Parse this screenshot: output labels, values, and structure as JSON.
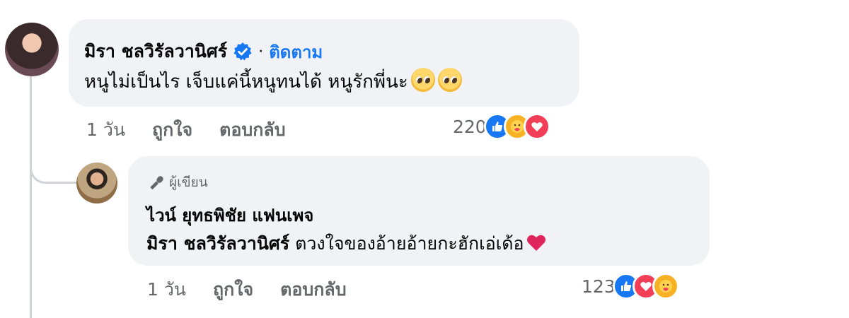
{
  "main_comment": {
    "author": "มิรา ชลวิรัลวานิศร์",
    "separator": "·",
    "follow_label": "ติดตาม",
    "text": "หนูไม่เป็นไร เจ็บแค่นี้หนูทนได้ หนูรักพี่นะ",
    "emoji": [
      "pleading-face-icon",
      "pleading-face-icon"
    ],
    "time": "1 วัน",
    "like_label": "ถูกใจ",
    "reply_label": "ตอบกลับ",
    "reaction_count": "220",
    "reactions": [
      "like-icon",
      "care-icon",
      "love-icon"
    ]
  },
  "reply_comment": {
    "author_badge": "ผู้เขียน",
    "page_name": "ไวน์ ยุทธพิชัย แฟนเพจ",
    "mention": "มิรา ชลวิรัลวานิศร์",
    "text": "ตวงใจของอ้ายอ้ายกะฮักเอ่เด้อ",
    "emoji": "red-heart-icon",
    "time": "1 วัน",
    "like_label": "ถูกใจ",
    "reply_label": "ตอบกลับ",
    "reaction_count": "123",
    "reactions": [
      "like-icon",
      "love-icon",
      "care-icon"
    ]
  },
  "colors": {
    "bubble_bg": "#f0f2f5",
    "link_blue": "#1877f2",
    "meta_gray": "#65676b",
    "like": "#1877f2",
    "love": "#f33e58",
    "care": "#f7b125"
  }
}
